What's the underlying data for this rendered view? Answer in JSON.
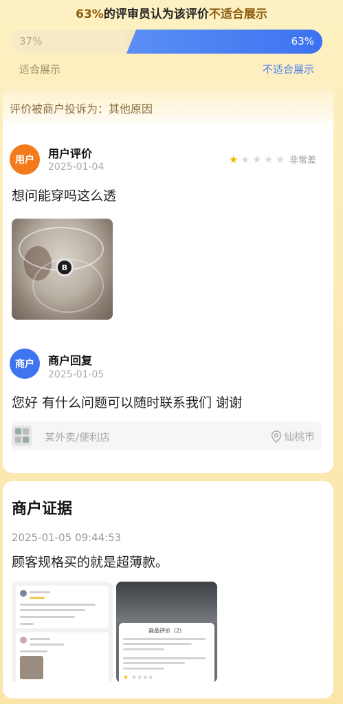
{
  "header": {
    "percent": "63%",
    "pre": "的评审员认为该评价",
    "highlight": "不适合展示"
  },
  "vote_bar": {
    "left_pct": "37%",
    "right_pct": "63%",
    "left_label": "适合展示",
    "right_label": "不适合展示",
    "not_suitable_fraction": 0.63,
    "colors": {
      "left": "#f6ebc6",
      "right": "#3c72f0"
    }
  },
  "complaint": {
    "text": "评价被商户投诉为：其他原因"
  },
  "user_review": {
    "avatar_text": "用户",
    "title": "用户评价",
    "date": "2025-01-04",
    "rating": 1,
    "rating_max": 5,
    "rating_label": "非常差",
    "content": "想问能穿吗这么透"
  },
  "merchant_reply": {
    "avatar_text": "商户",
    "title": "商户回复",
    "date": "2025-01-05",
    "content": "您好 有什么问题可以随时联系我们 谢谢"
  },
  "store": {
    "name": "某外卖/便利店",
    "location": "仙桃市"
  },
  "evidence": {
    "title": "商户证据",
    "datetime": "2025-01-05 09:44:53",
    "content": "顾客规格买的就是超薄款。",
    "screenshot_sheet_title": "商品评价（2）"
  }
}
